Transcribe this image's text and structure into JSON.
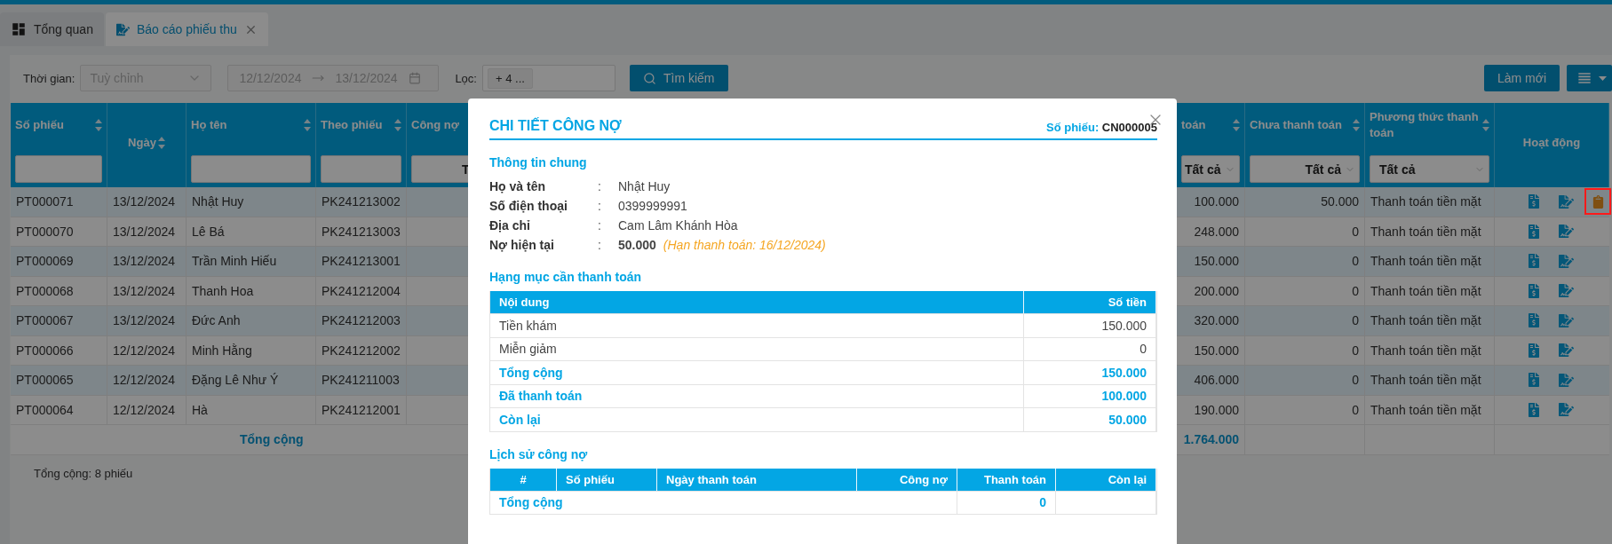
{
  "tabs": [
    {
      "label": "Tổng quan",
      "selected": false,
      "kind": "dashboard",
      "closable": false
    },
    {
      "label": "Báo cáo phiếu thu",
      "selected": true,
      "kind": "report",
      "closable": true
    }
  ],
  "toolbar": {
    "time_label": "Thời gian:",
    "time_select": {
      "placeholder": "Tuỳ chỉnh",
      "disabled": true
    },
    "date_range": {
      "from": "12/12/2024",
      "to": "13/12/2024",
      "disabled": true
    },
    "filter_label": "Lọc:",
    "filter_tag": "+ 4 ...",
    "search_button": "Tìm kiếm",
    "refresh_button": "Làm mới"
  },
  "table": {
    "columns": [
      {
        "label": "Số phiếu",
        "sortable": true,
        "filter": {
          "kind": "input"
        }
      },
      {
        "label": "Ngày",
        "sortable": true,
        "filter": {
          "kind": "none"
        }
      },
      {
        "label": "Họ tên",
        "sortable": true,
        "filter": {
          "kind": "input"
        }
      },
      {
        "label": "Theo phiếu",
        "sortable": true,
        "filter": {
          "kind": "input"
        }
      },
      {
        "label": "Công nợ",
        "sortable": false,
        "filter": {
          "kind": "select",
          "value": "T"
        }
      },
      {
        "label": "toán",
        "sortable": true,
        "filter": {
          "kind": "select",
          "value": "Tất cả"
        }
      },
      {
        "label": "Chưa thanh toán",
        "sortable": true,
        "filter": {
          "kind": "select",
          "value": "Tất cả"
        }
      },
      {
        "label": "Phương thức thanh toán",
        "sortable": true,
        "filter": {
          "kind": "select",
          "value": "Tất cả"
        }
      },
      {
        "label": "Hoạt động",
        "sortable": false,
        "filter": {
          "kind": "none"
        }
      }
    ],
    "rows": [
      {
        "so_phieu": "PT000071",
        "ngay": "13/12/2024",
        "ho_ten": "Nhật Huy",
        "theo_phieu": "PK241213002",
        "column_6": "100.000",
        "chua_thanh_toan": "50.000",
        "phuong_thuc": "Thanh toán tiền mặt",
        "debt_icon": true,
        "highlighted": true
      },
      {
        "so_phieu": "PT000070",
        "ngay": "13/12/2024",
        "ho_ten": "Lê Bá",
        "theo_phieu": "PK241213003",
        "column_6": "248.000",
        "chua_thanh_toan": "0",
        "phuong_thuc": "Thanh toán tiền mặt",
        "debt_icon": false,
        "highlighted": false
      },
      {
        "so_phieu": "PT000069",
        "ngay": "13/12/2024",
        "ho_ten": "Trần Minh Hiếu",
        "theo_phieu": "PK241213001",
        "column_6": "150.000",
        "chua_thanh_toan": "0",
        "phuong_thuc": "Thanh toán tiền mặt",
        "debt_icon": false,
        "highlighted": false
      },
      {
        "so_phieu": "PT000068",
        "ngay": "13/12/2024",
        "ho_ten": "Thanh Hoa",
        "theo_phieu": "PK241212004",
        "column_6": "200.000",
        "chua_thanh_toan": "0",
        "phuong_thuc": "Thanh toán tiền mặt",
        "debt_icon": false,
        "highlighted": false
      },
      {
        "so_phieu": "PT000067",
        "ngay": "13/12/2024",
        "ho_ten": "Đức Anh",
        "theo_phieu": "PK241212003",
        "column_6": "320.000",
        "chua_thanh_toan": "0",
        "phuong_thuc": "Thanh toán tiền mặt",
        "debt_icon": false,
        "highlighted": false
      },
      {
        "so_phieu": "PT000066",
        "ngay": "12/12/2024",
        "ho_ten": "Minh Hằng",
        "theo_phieu": "PK241212002",
        "column_6": "150.000",
        "chua_thanh_toan": "0",
        "phuong_thuc": "Thanh toán tiền mặt",
        "debt_icon": false,
        "highlighted": false
      },
      {
        "so_phieu": "PT000065",
        "ngay": "12/12/2024",
        "ho_ten": "Đặng Lê Như Ý",
        "theo_phieu": "PK241211003",
        "column_6": "406.000",
        "chua_thanh_toan": "0",
        "phuong_thuc": "Thanh toán tiền mặt",
        "debt_icon": false,
        "highlighted": false
      },
      {
        "so_phieu": "PT000064",
        "ngay": "12/12/2024",
        "ho_ten": "Hà",
        "theo_phieu": "PK241212001",
        "column_6": "190.000",
        "chua_thanh_toan": "0",
        "phuong_thuc": "Thanh toán tiền mặt",
        "debt_icon": false,
        "highlighted": false
      }
    ],
    "total": {
      "label": "Tổng cộng",
      "column_6": "1.764.000"
    },
    "footer": "Tổng cộng: 8 phiếu"
  },
  "modal": {
    "title": "CHI TIẾT CÔNG NỢ",
    "code_label": "Số phiếu:",
    "code": "CN000005",
    "general": {
      "heading": "Thông tin chung",
      "rows": [
        {
          "kind": "plain",
          "label": "Họ và tên",
          "colon": ":",
          "value": "Nhật Huy"
        },
        {
          "kind": "plain",
          "label": "Số điện thoại",
          "colon": ":",
          "value": "0399999991"
        },
        {
          "kind": "plain",
          "label": "Địa chỉ",
          "colon": ":",
          "value": "Cam Lâm Khánh Hòa"
        },
        {
          "kind": "debt",
          "label": "Nợ hiện tại",
          "colon": ":",
          "value": "50.000",
          "note": "(Hạn thanh toán: 16/12/2024)"
        }
      ]
    },
    "items": {
      "heading": "Hạng mục cần thanh toán",
      "columns": [
        "Nội dung",
        "Số tiền"
      ],
      "rows": [
        {
          "kind": "item",
          "label": "Tiền khám",
          "amount": "150.000"
        },
        {
          "kind": "item",
          "label": "Miễn giảm",
          "amount": "0"
        },
        {
          "kind": "summary",
          "label": "Tổng cộng",
          "amount": "150.000"
        },
        {
          "kind": "summary",
          "label": "Đã thanh toán",
          "amount": "100.000"
        },
        {
          "kind": "summary",
          "label": "Còn lại",
          "amount": "50.000"
        }
      ]
    },
    "history": {
      "heading": "Lịch sử công nợ",
      "columns": [
        "#",
        "Số phiếu",
        "Ngày thanh toán",
        "Công nợ",
        "Thanh toán",
        "Còn lại"
      ],
      "total": {
        "label": "Tổng cộng",
        "paid": "0"
      }
    }
  }
}
